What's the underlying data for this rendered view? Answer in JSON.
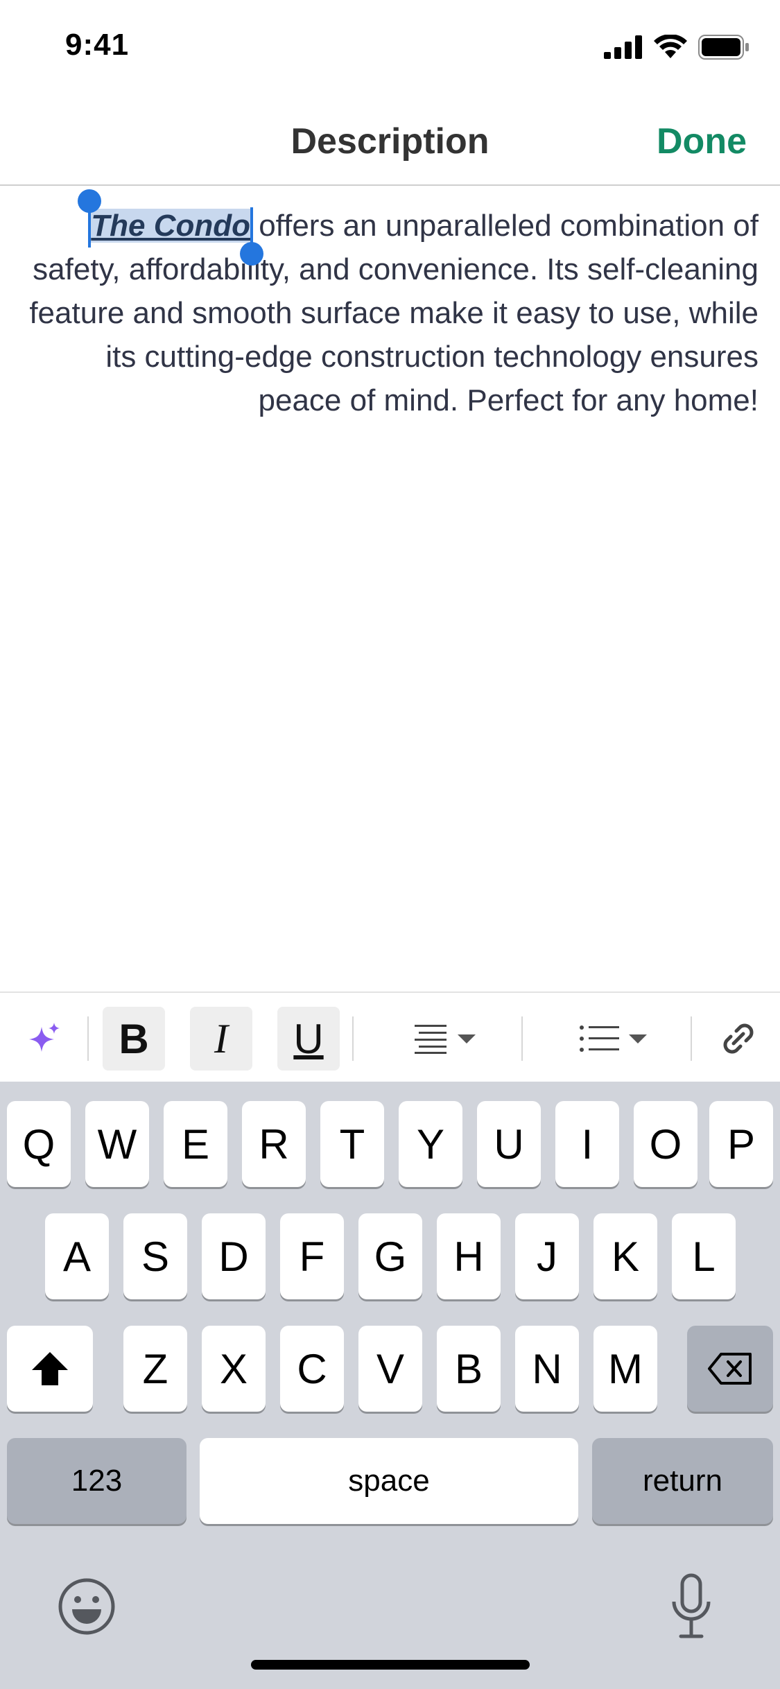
{
  "status_bar": {
    "time": "9:41"
  },
  "nav": {
    "title": "Description",
    "done_label": "Done"
  },
  "editor": {
    "selected_text": "The Condo",
    "body_text": " offers an unparalleled combination of safety, affordability, and convenience. Its self-cleaning feature and smooth surface make it easy to use, while its cutting-edge construction technology ensures peace of mind. Perfect for any home!"
  },
  "toolbar": {
    "bold_label": "B",
    "italic_label": "I",
    "underline_label": "U"
  },
  "keyboard": {
    "row1": [
      "Q",
      "W",
      "E",
      "R",
      "T",
      "Y",
      "U",
      "I",
      "O",
      "P"
    ],
    "row2": [
      "A",
      "S",
      "D",
      "F",
      "G",
      "H",
      "J",
      "K",
      "L"
    ],
    "row3": [
      "Z",
      "X",
      "C",
      "V",
      "B",
      "N",
      "M"
    ],
    "numbers_label": "123",
    "space_label": "space",
    "return_label": "return"
  },
  "colors": {
    "accent": "#138a64",
    "selection": "#c8d8ee",
    "caret": "#2476de",
    "ai_sparkle": "#8a5cf0"
  }
}
